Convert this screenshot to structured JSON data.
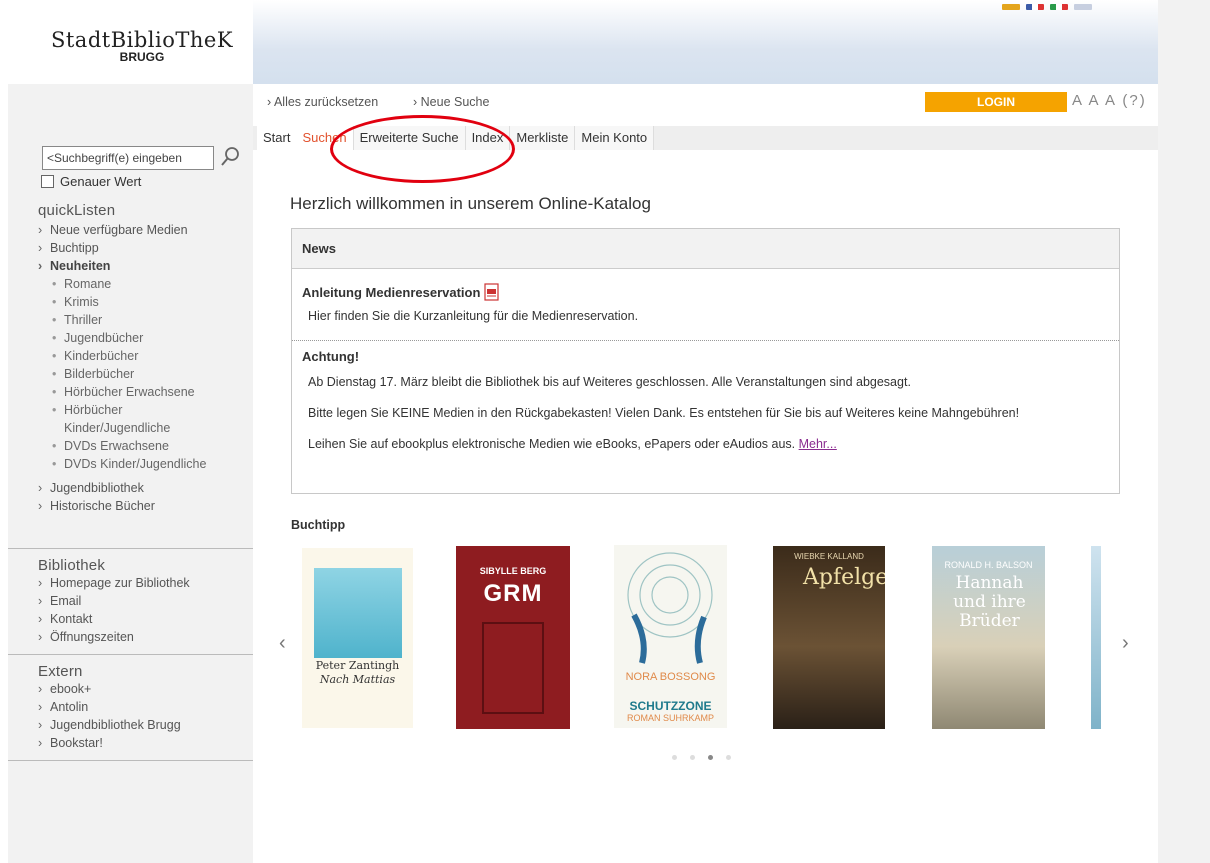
{
  "header": {
    "logo_name": "StadtBiblioTheK",
    "logo_sub": "BRUGG"
  },
  "colors": {
    "accent": "#f5a300",
    "active_tab": "#e2522e",
    "annotation": "#e1000f"
  },
  "search": {
    "placeholder": "<Suchbegriff(e) eingeben",
    "exact_label": "Genauer Wert"
  },
  "breadcrumb": {
    "reset": "Alles zurücksetzen",
    "new_search": "Neue Suche"
  },
  "login_label": "LOGIN",
  "fontsizes": "A A A (?)",
  "tabs": [
    {
      "label": "Start"
    },
    {
      "label": "Suchen"
    },
    {
      "label": "Erweiterte Suche"
    },
    {
      "label": "Index"
    },
    {
      "label": "Merkliste"
    },
    {
      "label": "Mein Konto"
    }
  ],
  "sidebar": {
    "quicklisten_title": "quickListen",
    "quick": [
      {
        "label": "Neue verfügbare Medien"
      },
      {
        "label": "Buchtipp"
      },
      {
        "label": "Neuheiten"
      }
    ],
    "neuheiten": [
      "Romane",
      "Krimis",
      "Thriller",
      "Jugendbücher",
      "Kinderbücher",
      "Bilderbücher",
      "Hörbücher Erwachsene",
      "Hörbücher Kinder/Jugendliche",
      "DVDs Erwachsene",
      "DVDs Kinder/Jugendliche"
    ],
    "more": [
      "Jugendbibliothek",
      "Historische Bücher"
    ],
    "bibliothek_title": "Bibliothek",
    "bibliothek": [
      "Homepage zur Bibliothek",
      "Email",
      "Kontakt",
      "Öffnungszeiten"
    ],
    "extern_title": "Extern",
    "extern": [
      "ebook+",
      "Antolin",
      "Jugendbibliothek Brugg",
      "Bookstar!"
    ]
  },
  "main": {
    "welcome": "Herzlich willkommen in unserem Online-Katalog",
    "news_title": "News",
    "item1_title": "Anleitung Medienreservation",
    "item1_text": "Hier finden Sie die Kurzanleitung für die Medienreservation.",
    "item2_title": "Achtung!",
    "item2_p1": "Ab Dienstag 17. März bleibt die Bibliothek bis auf Weiteres geschlossen. Alle Veranstaltungen sind abgesagt.",
    "item2_p2": "Bitte legen Sie KEINE Medien in den Rückgabekasten! Vielen Dank. Es entstehen für Sie bis auf Weiteres keine Mahngebühren!",
    "item2_p3": "Leihen Sie auf ebookplus elektronische Medien wie eBooks, ePapers oder eAudios aus.",
    "more_link": "Mehr...",
    "buchtipp_title": "Buchtipp"
  },
  "books": [
    {
      "author": "Peter Zantingh",
      "title": "Nach Mattias"
    },
    {
      "author": "SIBYLLE BERG",
      "title": "GRM"
    },
    {
      "author": "NORA BOSSONG",
      "title": "SCHUTZZONE",
      "footer": "ROMAN SUHRKAMP"
    },
    {
      "author": "WIEBKE KALLAND",
      "title": "Apfelgelb"
    },
    {
      "author": "RONALD H. BALSON",
      "title": "Hannah und ihre Brüder"
    }
  ],
  "carousel": {
    "prev": "‹",
    "next": "›"
  }
}
